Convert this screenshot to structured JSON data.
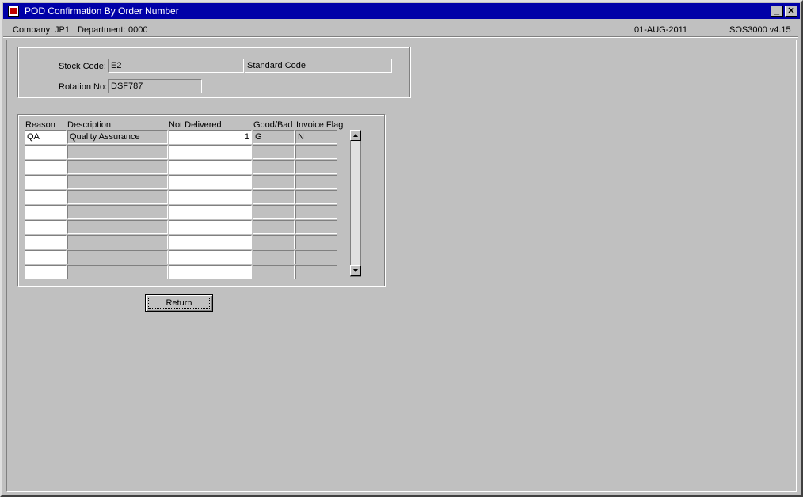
{
  "window": {
    "title": "POD Confirmation By Order Number"
  },
  "info": {
    "company_label": "Company:",
    "company": "JP1",
    "department_label": "Department:",
    "department": "0000",
    "date": "01-AUG-2011",
    "version": "SOS3000  v4.15"
  },
  "stock": {
    "stock_code_label": "Stock Code:",
    "stock_code": "E2",
    "stock_desc": "Standard Code",
    "rotation_label": "Rotation No:",
    "rotation": "DSF787"
  },
  "grid": {
    "headers": {
      "reason": "Reason",
      "description": "Description",
      "not_delivered": "Not Delivered",
      "good_bad": "Good/Bad",
      "invoice_flag": "Invoice Flag"
    },
    "rows": [
      {
        "reason": "QA",
        "description": "Quality Assurance",
        "not_delivered": "1",
        "good_bad": "G",
        "invoice_flag": "N"
      },
      {
        "reason": "",
        "description": "",
        "not_delivered": "",
        "good_bad": "",
        "invoice_flag": ""
      },
      {
        "reason": "",
        "description": "",
        "not_delivered": "",
        "good_bad": "",
        "invoice_flag": ""
      },
      {
        "reason": "",
        "description": "",
        "not_delivered": "",
        "good_bad": "",
        "invoice_flag": ""
      },
      {
        "reason": "",
        "description": "",
        "not_delivered": "",
        "good_bad": "",
        "invoice_flag": ""
      },
      {
        "reason": "",
        "description": "",
        "not_delivered": "",
        "good_bad": "",
        "invoice_flag": ""
      },
      {
        "reason": "",
        "description": "",
        "not_delivered": "",
        "good_bad": "",
        "invoice_flag": ""
      },
      {
        "reason": "",
        "description": "",
        "not_delivered": "",
        "good_bad": "",
        "invoice_flag": ""
      },
      {
        "reason": "",
        "description": "",
        "not_delivered": "",
        "good_bad": "",
        "invoice_flag": ""
      },
      {
        "reason": "",
        "description": "",
        "not_delivered": "",
        "good_bad": "",
        "invoice_flag": ""
      }
    ]
  },
  "buttons": {
    "return_label": "Return"
  }
}
